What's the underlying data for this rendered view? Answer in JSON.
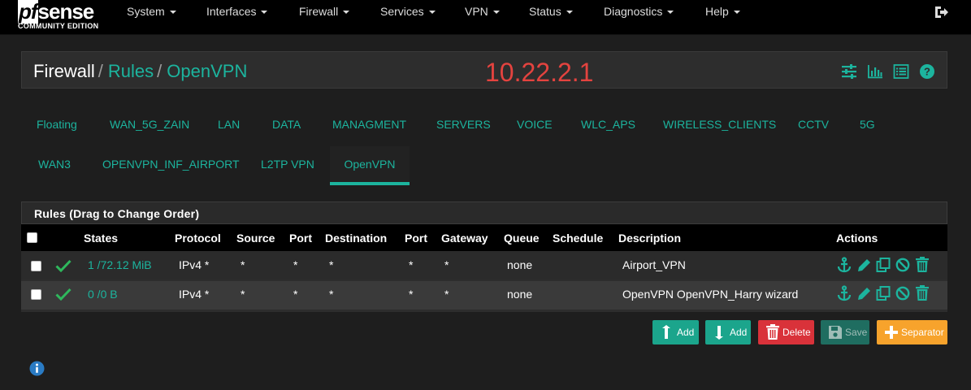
{
  "brand": {
    "logo_pf": "pf",
    "logo_rest": "sense",
    "edition": "COMMUNITY EDITION"
  },
  "nav": [
    "System",
    "Interfaces",
    "Firewall",
    "Services",
    "VPN",
    "Status",
    "Diagnostics",
    "Help"
  ],
  "breadcrumb": {
    "first": "Firewall",
    "second": "Rules",
    "third": "OpenVPN",
    "separator": "/"
  },
  "host_ip": "10.22.2.1",
  "tabs": [
    "Floating",
    "WAN_5G_ZAIN",
    "LAN",
    "DATA",
    "MANAGMENT",
    "SERVERS",
    "VOICE",
    "WLC_APS",
    "WIRELESS_CLIENTS",
    "CCTV",
    "5G",
    "WAN3",
    "OPENVPN_INF_AIRPORT",
    "L2TP VPN",
    "OpenVPN"
  ],
  "active_tab": "OpenVPN",
  "rules_title": "Rules (Drag to Change Order)",
  "columns": [
    "States",
    "Protocol",
    "Source",
    "Port",
    "Destination",
    "Port",
    "Gateway",
    "Queue",
    "Schedule",
    "Description",
    "Actions"
  ],
  "rows": [
    {
      "states": "1 /72.12 MiB",
      "protocol": "IPv4 *",
      "source": "*",
      "sport": "*",
      "destination": "*",
      "dport": "*",
      "gateway": "*",
      "queue": "none",
      "schedule": "",
      "description": "Airport_VPN"
    },
    {
      "states": "0 /0 B",
      "protocol": "IPv4 *",
      "source": "*",
      "sport": "*",
      "destination": "*",
      "dport": "*",
      "gateway": "*",
      "queue": "none",
      "schedule": "",
      "description": "OpenVPN OpenVPN_Harry wizard"
    }
  ],
  "buttons": {
    "add_top": "Add",
    "add_bottom": "Add",
    "delete": "Delete",
    "save": "Save",
    "separator": "Separator"
  },
  "colors": {
    "accent": "#1cb49e",
    "ip": "#e4433f",
    "green_btn": "#1ba58c",
    "delete_btn": "#d9323a",
    "save_btn": "#1f6d60",
    "separator_btn": "#f7a32c",
    "pass_check": "#2eb85c"
  },
  "icons": {
    "logout": "logout-icon",
    "crumb": [
      "sliders-icon",
      "chart-icon",
      "list-icon",
      "help-icon"
    ],
    "row_actions": [
      "anchor-icon",
      "pencil-icon",
      "copy-icon",
      "disable-icon",
      "trash-icon"
    ],
    "info": "info-icon"
  }
}
